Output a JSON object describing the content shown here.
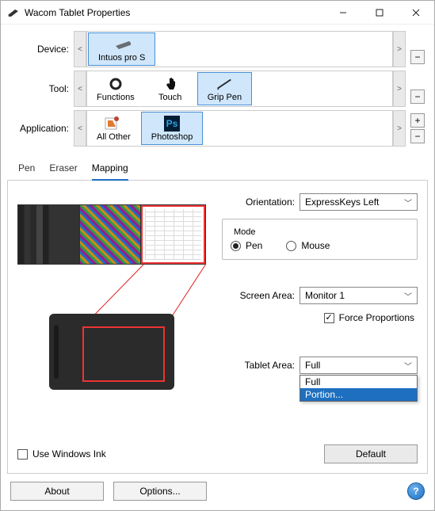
{
  "window": {
    "title": "Wacom Tablet Properties"
  },
  "selectors": {
    "device_label": "Device:",
    "devices": [
      {
        "label": "Intuos pro S",
        "selected": true
      }
    ],
    "tool_label": "Tool:",
    "tools": [
      {
        "label": "Functions",
        "selected": false
      },
      {
        "label": "Touch",
        "selected": false
      },
      {
        "label": "Grip Pen",
        "selected": true
      }
    ],
    "app_label": "Application:",
    "apps": [
      {
        "label": "All Other",
        "selected": false
      },
      {
        "label": "Photoshop",
        "selected": true
      }
    ]
  },
  "tabs": {
    "items": [
      "Pen",
      "Eraser",
      "Mapping"
    ],
    "active": 2
  },
  "mapping": {
    "orientation_label": "Orientation:",
    "orientation_value": "ExpressKeys Left",
    "mode_label": "Mode",
    "mode_options": {
      "pen": "Pen",
      "mouse": "Mouse"
    },
    "mode_value": "Pen",
    "screen_area_label": "Screen Area:",
    "screen_area_value": "Monitor 1",
    "force_proportions_label": "Force Proportions",
    "force_proportions_checked": true,
    "tablet_area_label": "Tablet Area:",
    "tablet_area_value": "Full",
    "tablet_area_options": [
      "Full",
      "Portion..."
    ],
    "tablet_area_highlighted": 1,
    "use_windows_ink_label": "Use Windows Ink",
    "use_windows_ink_checked": false,
    "default_button": "Default"
  },
  "footer": {
    "about": "About",
    "options": "Options..."
  }
}
